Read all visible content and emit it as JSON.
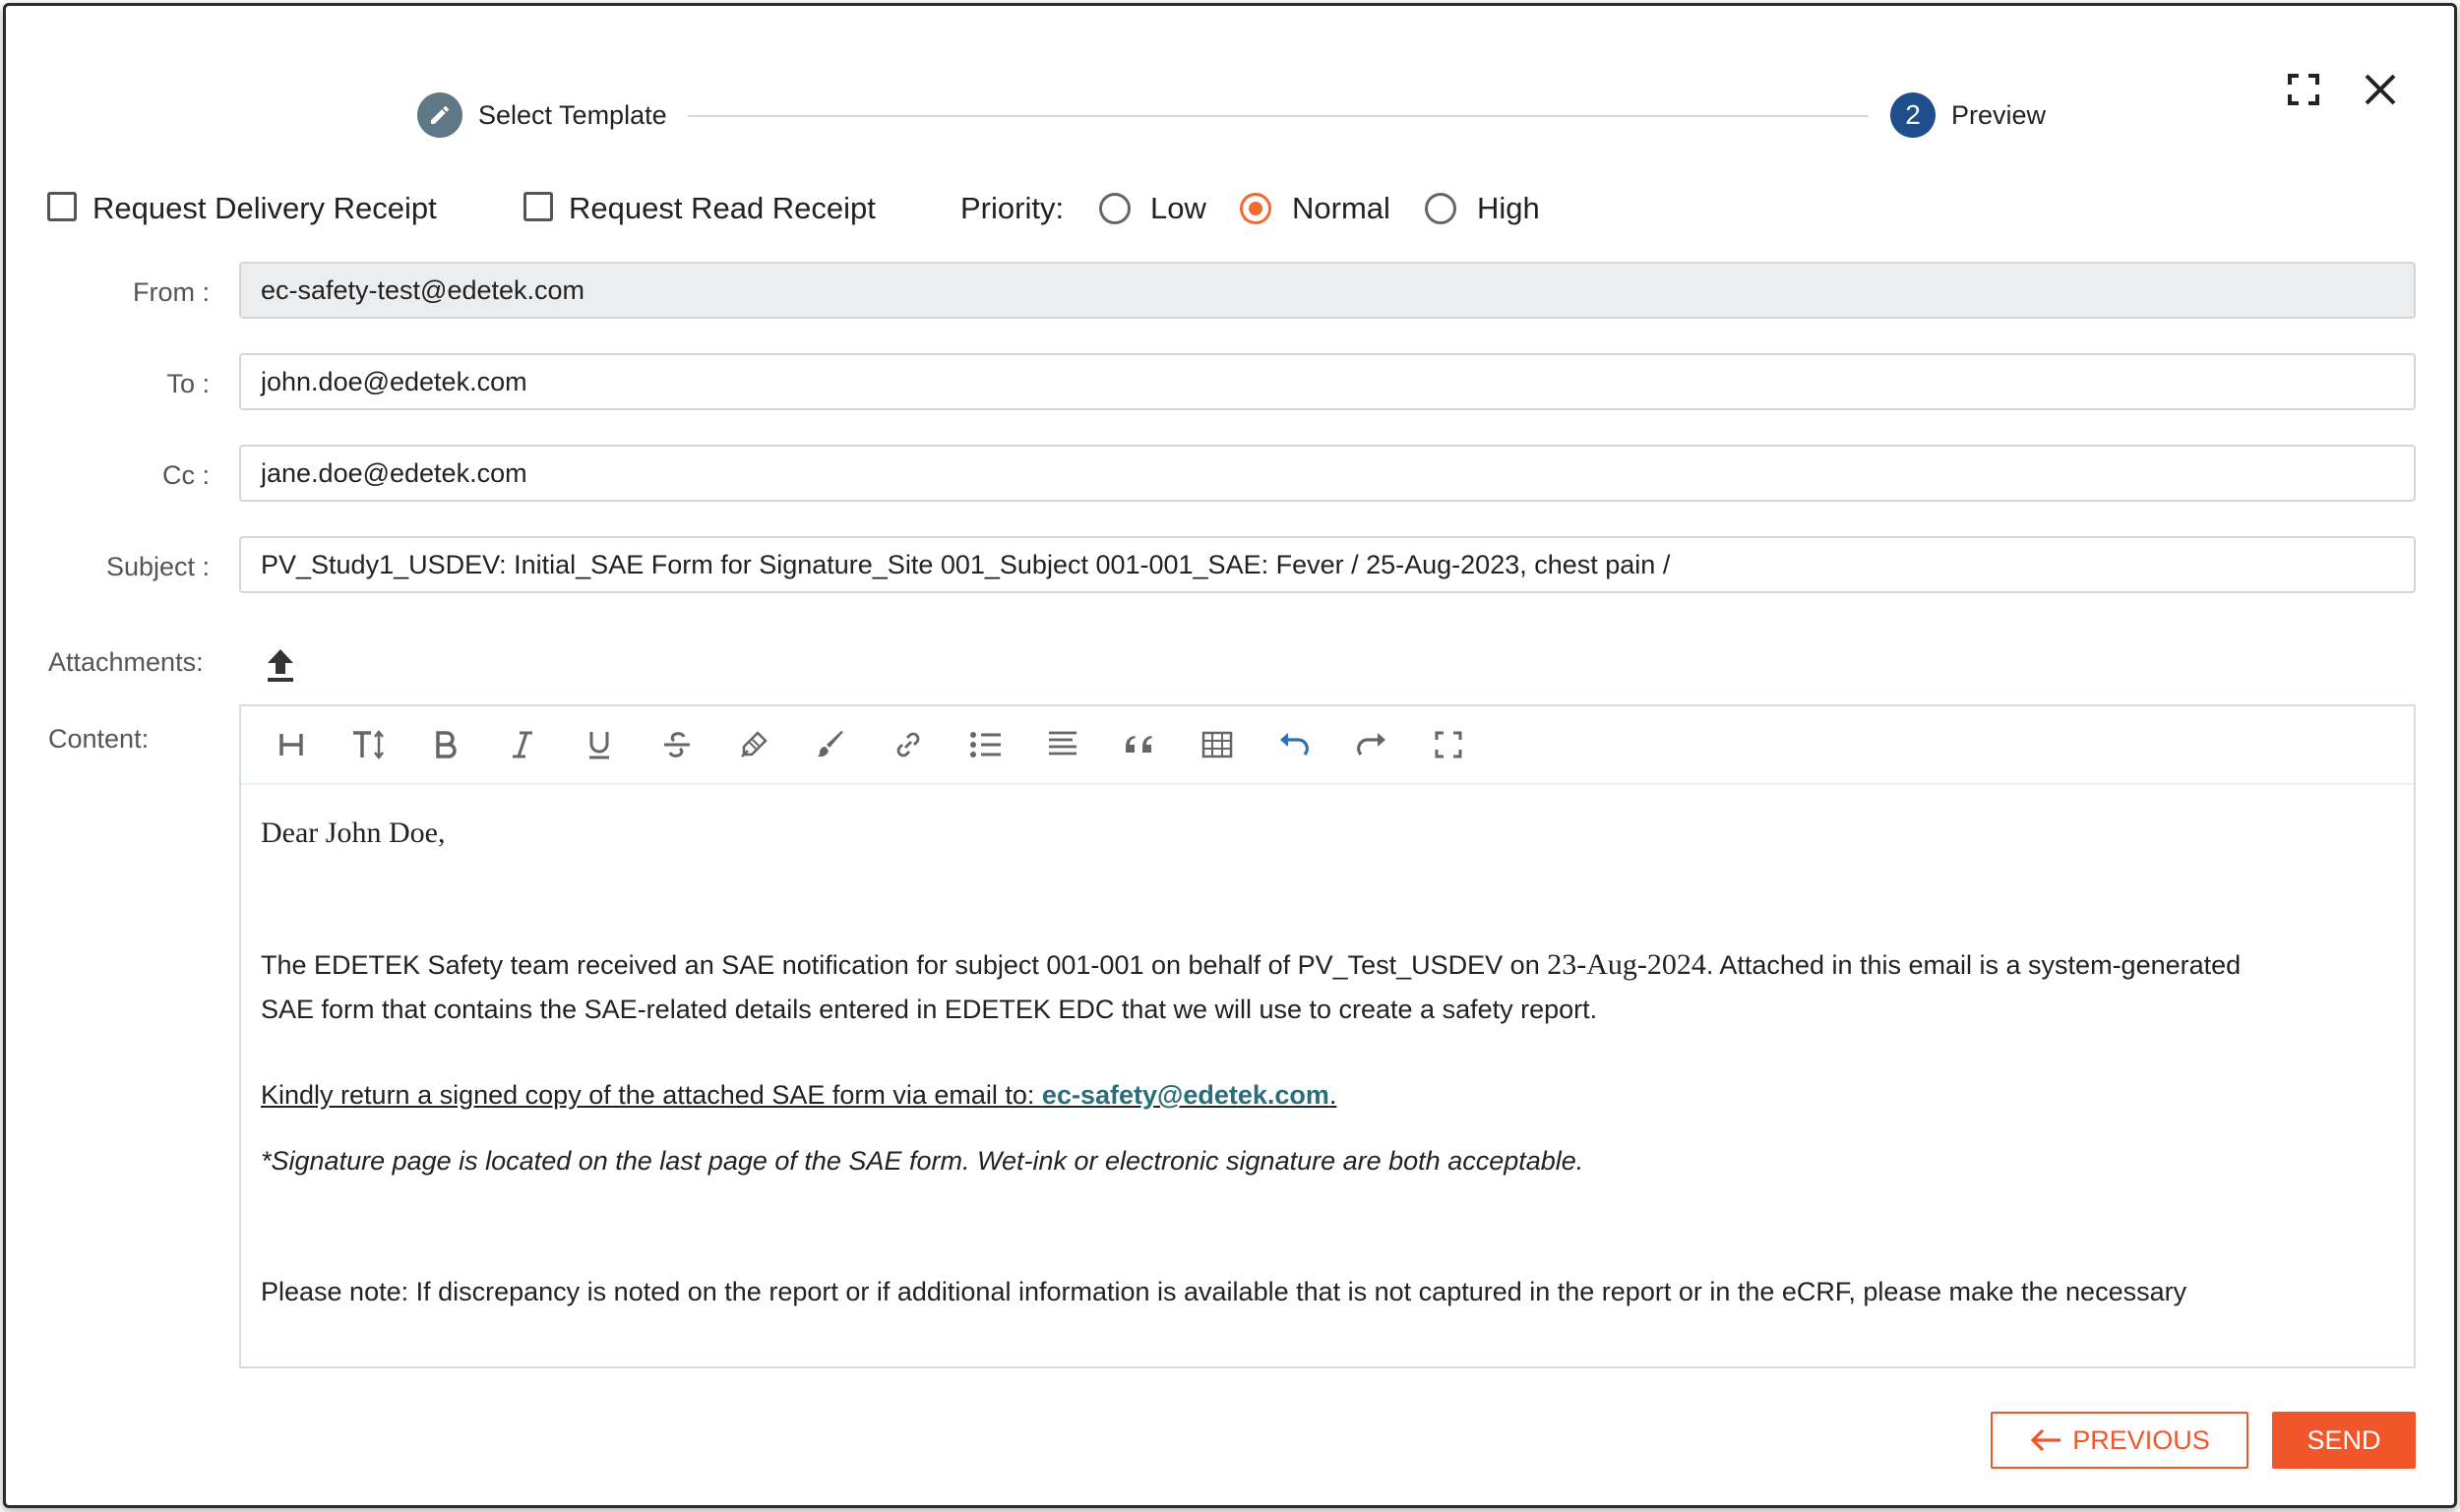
{
  "stepper": {
    "step1_label": "Select Template",
    "step2_number": "2",
    "step2_label": "Preview"
  },
  "options": {
    "delivery_receipt": "Request Delivery Receipt",
    "read_receipt": "Request Read Receipt",
    "priority_label": "Priority:",
    "priority_options": [
      "Low",
      "Normal",
      "High"
    ],
    "priority_selected": "Normal"
  },
  "fields": {
    "from_label": "From :",
    "from_value": "ec-safety-test@edetek.com",
    "to_label": "To :",
    "to_value": "john.doe@edetek.com",
    "cc_label": "Cc :",
    "cc_value": "jane.doe@edetek.com",
    "subject_label": "Subject :",
    "subject_value": "PV_Study1_USDEV: Initial_SAE Form for Signature_Site 001_Subject 001-001_SAE:  Fever / 25-Aug-2023, chest pain /",
    "attachments_label": "Attachments:",
    "content_label": "Content:"
  },
  "toolbar_icons": [
    "heading-icon",
    "text-size-icon",
    "bold-icon",
    "italic-icon",
    "underline-icon",
    "strikethrough-icon",
    "highlighter-icon",
    "brush-icon",
    "link-icon",
    "bullet-list-icon",
    "align-icon",
    "quote-icon",
    "table-icon",
    "undo-icon",
    "redo-icon",
    "fullscreen-icon"
  ],
  "content": {
    "greeting": "Dear John Doe,",
    "p1_a": "The EDETEK Safety team received an SAE notification for subject 001-001 on behalf of PV_Test_USDEV on ",
    "p1_date": "23-Aug-2024",
    "p1_b": ". Attached in this email is a system-generated",
    "p1_line2": "SAE form that contains the SAE-related details entered in EDETEK EDC that we will use to create a safety report.",
    "return_text": "Kindly return a signed copy of the attached SAE form via email to: ",
    "return_email": "ec-safety@edetek.com",
    "return_end": ".",
    "signature_note": "*Signature page is located on the last page of the SAE form. Wet-ink or electronic signature are both acceptable.",
    "please_note": "Please note: If discrepancy is noted on the report or if additional information is available that is not captured in the report or in the eCRF, please make the necessary"
  },
  "buttons": {
    "previous": "PREVIOUS",
    "send": "SEND"
  },
  "colors": {
    "accent": "#f0562a",
    "step_done": "#5f7786",
    "step_active": "#1f4e8c",
    "link": "#2a6e7c"
  }
}
